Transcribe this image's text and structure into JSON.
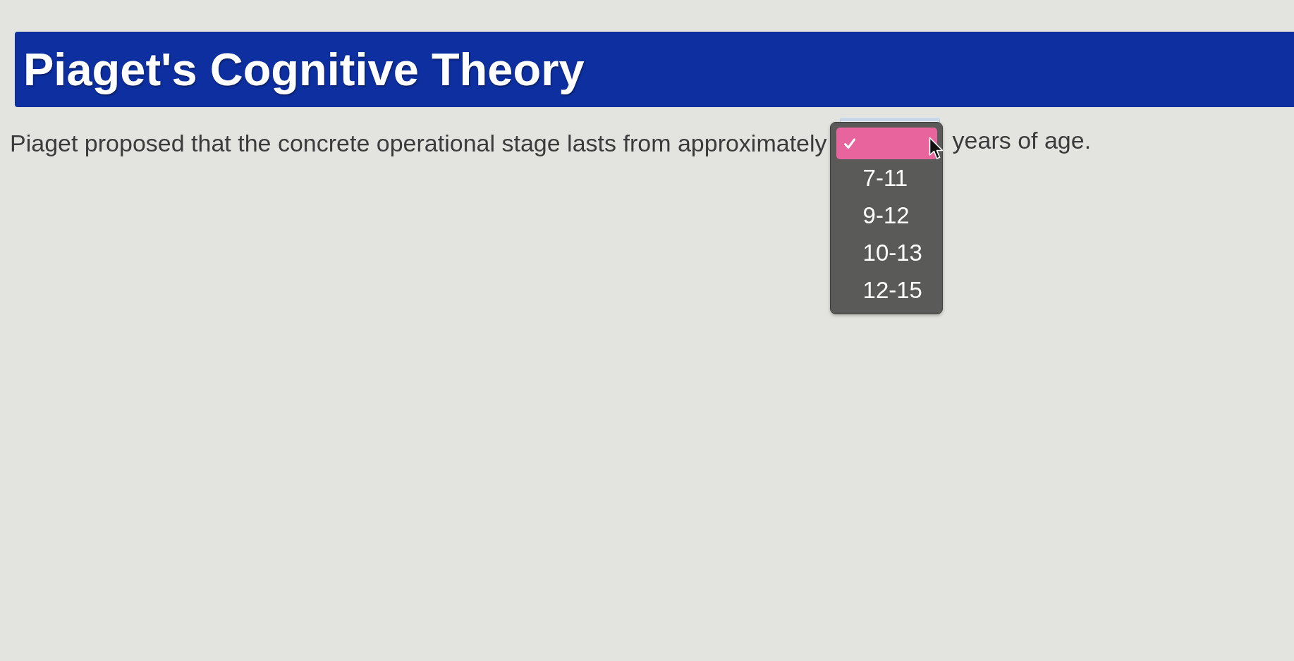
{
  "header": {
    "title": "Piaget's Cognitive Theory"
  },
  "question": {
    "text_before": "Piaget proposed that the concrete operational stage lasts from approximately",
    "dropdown": {
      "expanded": true,
      "options": [
        {
          "selected": true
        },
        {
          "label": "7-11",
          "selected": false
        },
        {
          "label": "9-12",
          "selected": false
        },
        {
          "label": "10-13",
          "selected": false
        },
        {
          "label": "12-15",
          "selected": false
        }
      ]
    },
    "text_after": "years of age."
  }
}
